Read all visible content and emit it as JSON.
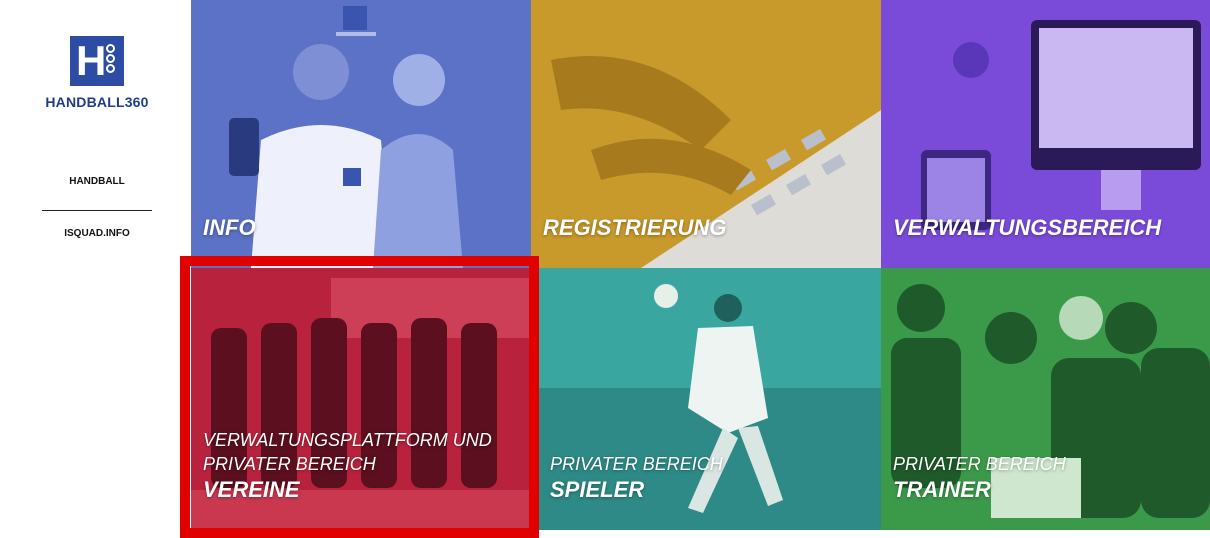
{
  "sidebar": {
    "logo_text": "HANDBALL360",
    "links": [
      "HANDBALL",
      "ISQUAD.INFO"
    ]
  },
  "tiles": {
    "info": {
      "sub": "",
      "main": "INFO"
    },
    "registrierung": {
      "sub": "",
      "main": "REGISTRIERUNG"
    },
    "verwaltungsbereich": {
      "sub": "",
      "main": "VERWALTUNGSBEREICH"
    },
    "vereine": {
      "sub": "VERWALTUNGSPLATTFORM UND PRIVATER BEREICH",
      "main": "VEREINE"
    },
    "spieler": {
      "sub": "PRIVATER BEREICH",
      "main": "SPIELER"
    },
    "trainer": {
      "sub": "PRIVATER BEREICH",
      "main": "TRAINER"
    }
  },
  "icons": {
    "logo": "handball360-logo-icon"
  },
  "colors": {
    "info": "#5b72c6",
    "registrierung": "#c89a2c",
    "verwaltungsbereich": "#7a4bd9",
    "vereine": "#b8223d",
    "spieler": "#3aa6a0",
    "trainer": "#3b9a4a",
    "highlight": "#e00000",
    "brand": "#2c4da3"
  }
}
